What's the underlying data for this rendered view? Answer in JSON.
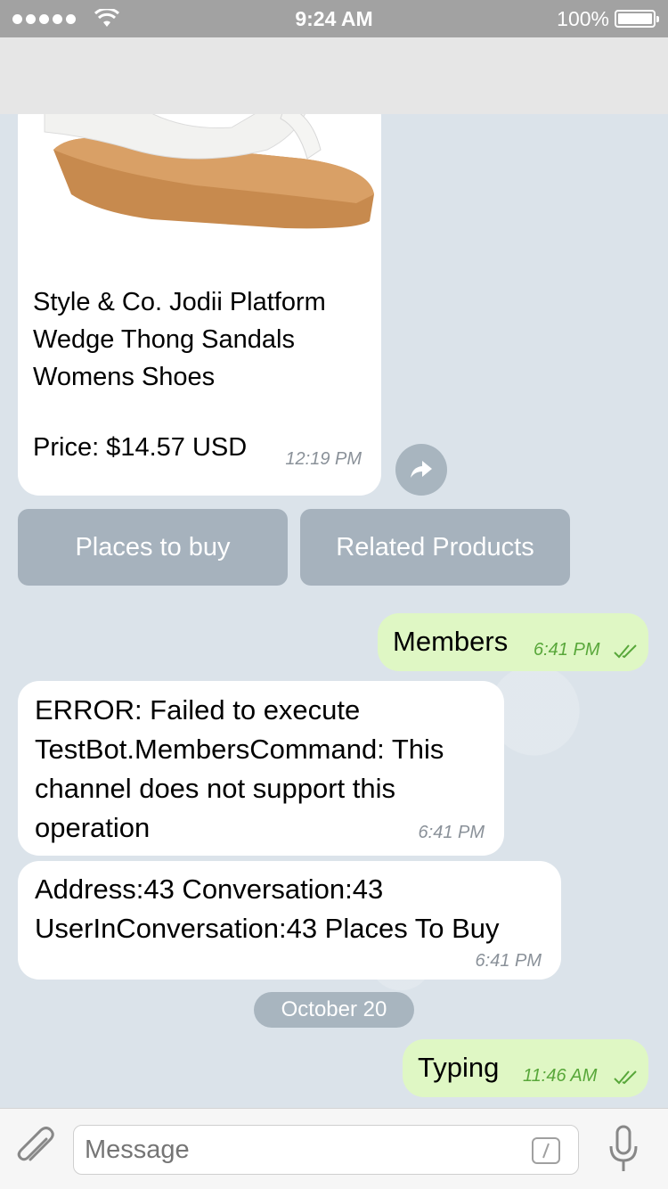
{
  "status_bar": {
    "time": "9:24 AM",
    "battery": "100%",
    "signal_icon": "signal-dots-icon",
    "wifi_icon": "wifi-icon"
  },
  "product": {
    "title": "Style & Co. Jodii Platform Wedge Thong Sandals Womens Shoes",
    "price": "Price: $14.57 USD",
    "time": "12:19 PM",
    "image_icon": "sandal-image"
  },
  "keyboard_buttons": [
    {
      "label": "Places to buy"
    },
    {
      "label": "Related Products"
    }
  ],
  "messages": [
    {
      "direction": "out",
      "text": "Members",
      "time": "6:41 PM"
    },
    {
      "direction": "in",
      "text": "ERROR: Failed to execute TestBot.MembersCommand: This channel does not support this operation",
      "time": "6:41 PM"
    },
    {
      "direction": "in",
      "text": "Address:43 Conversation:43 UserInConversation:43 Places To Buy",
      "time": "6:41 PM"
    },
    {
      "direction": "out",
      "text": "Typing",
      "time": "11:46 AM"
    }
  ],
  "date_separator": "October 20",
  "input": {
    "placeholder": "Message"
  },
  "colors": {
    "outgoing_bubble": "#dff7c4",
    "incoming_bubble": "#ffffff",
    "chat_background": "#dbe3ea",
    "accent_green": "#58a73a",
    "button_gray": "#a6b2bd"
  }
}
